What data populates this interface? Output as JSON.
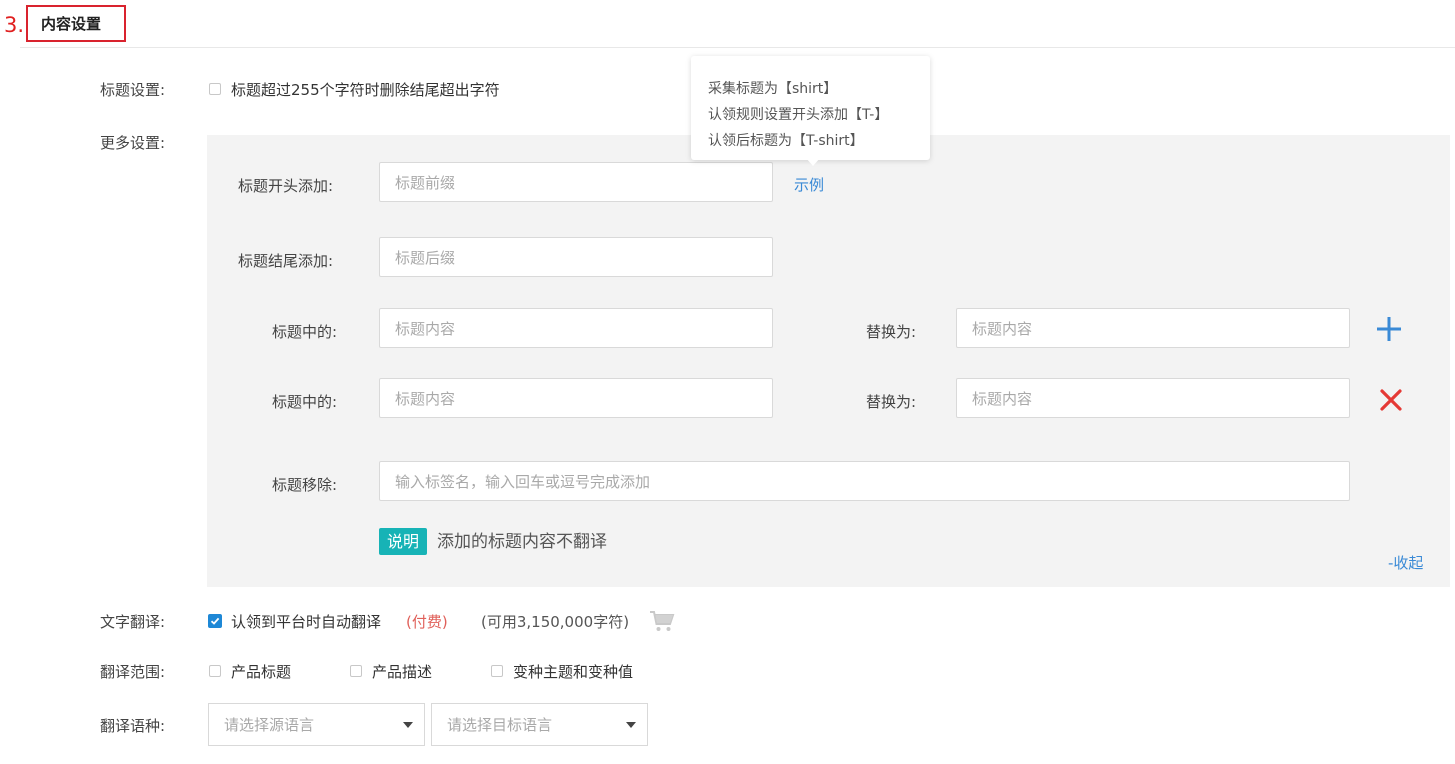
{
  "header": {
    "step": "3.",
    "title": "内容设置"
  },
  "title_setting": {
    "label": "标题设置:",
    "checkbox_label": "标题超过255个字符时删除结尾超出字符",
    "checked": false
  },
  "more_settings": {
    "label": "更多设置:",
    "prefix": {
      "label": "标题开头添加:",
      "placeholder": "标题前缀",
      "example_link": "示例"
    },
    "suffix": {
      "label": "标题结尾添加:",
      "placeholder": "标题后缀"
    },
    "replace_rows": [
      {
        "label": "标题中的:",
        "placeholder": "标题内容",
        "replace_label": "替换为:",
        "replace_placeholder": "标题内容",
        "action": "add"
      },
      {
        "label": "标题中的:",
        "placeholder": "标题内容",
        "replace_label": "替换为:",
        "replace_placeholder": "标题内容",
        "action": "remove"
      }
    ],
    "remove": {
      "label": "标题移除:",
      "placeholder": "输入标签名，输入回车或逗号完成添加"
    },
    "note_badge": "说明",
    "note_text": "添加的标题内容不翻译",
    "collapse_link": "-收起"
  },
  "tooltip": {
    "lines": [
      "采集标题为【shirt】",
      "认领规则设置开头添加【T-】",
      "认领后标题为【T-shirt】"
    ]
  },
  "translation": {
    "label": "文字翻译:",
    "checkbox_label": "认领到平台时自动翻译",
    "checked": true,
    "paid": "(付费)",
    "available": "(可用3,150,000字符)"
  },
  "translate_scope": {
    "label": "翻译范围:",
    "options": [
      {
        "label": "产品标题",
        "checked": false
      },
      {
        "label": "产品描述",
        "checked": false
      },
      {
        "label": "变种主题和变种值",
        "checked": false
      }
    ]
  },
  "translate_lang": {
    "label": "翻译语种:",
    "source_placeholder": "请选择源语言",
    "target_placeholder": "请选择目标语言"
  },
  "colors": {
    "accent_blue": "#3a8ad6",
    "delete_red": "#e53935",
    "header_border": "#d9232e",
    "badge_teal": "#17b3b6",
    "paid_red": "#e0605a"
  }
}
